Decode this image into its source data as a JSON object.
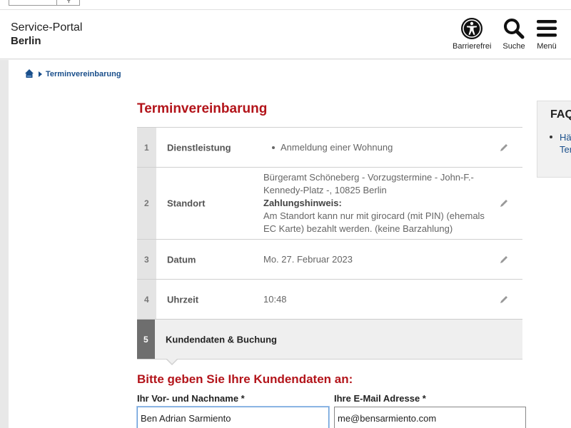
{
  "header": {
    "brand_line1": "Service-Portal",
    "brand_line2": "Berlin",
    "nav": [
      {
        "label": "Barrierefrei",
        "icon": "accessibility-icon"
      },
      {
        "label": "Suche",
        "icon": "search-icon"
      },
      {
        "label": "Menü",
        "icon": "hamburger-menu-icon"
      }
    ]
  },
  "breadcrumb": {
    "home_icon": "home-icon",
    "current": "Terminvereinbarung"
  },
  "page": {
    "title": "Terminvereinbarung"
  },
  "steps": [
    {
      "number": "1",
      "label": "Dienstleistung",
      "value": "Anmeldung einer Wohnung"
    },
    {
      "number": "2",
      "label": "Standort",
      "value_line1": "Bürgeramt Schöneberg - Vorzugstermine - John-F.-",
      "value_line2": "Kennedy-Platz -, 10825 Berlin",
      "hint_title": "Zahlungshinweis:",
      "hint_line1": "Am Standort kann nur mit girocard (mit PIN) (ehemals",
      "hint_line2": "EC Karte) bezahlt werden. (keine Barzahlung)"
    },
    {
      "number": "3",
      "label": "Datum",
      "value": "Mo. 27. Februar 2023"
    },
    {
      "number": "4",
      "label": "Uhrzeit",
      "value": "10:48"
    },
    {
      "number": "5",
      "label": "Kundendaten & Buchung"
    }
  ],
  "form": {
    "heading": "Bitte geben Sie Ihre Kundendaten an:",
    "name_label": "Ihr Vor- und Nachname *",
    "name_value": "Ben Adrian Sarmiento",
    "email_label": "Ihre E-Mail Adresse *",
    "email_value": "me@bensarmiento.com"
  },
  "faq": {
    "title": "FAQ",
    "link_line1": "Hä",
    "link_line2": "Ter"
  },
  "colors": {
    "accent_red": "#b3141a",
    "link_blue": "#1a4f8b",
    "active_step": "#6e6e6e"
  }
}
